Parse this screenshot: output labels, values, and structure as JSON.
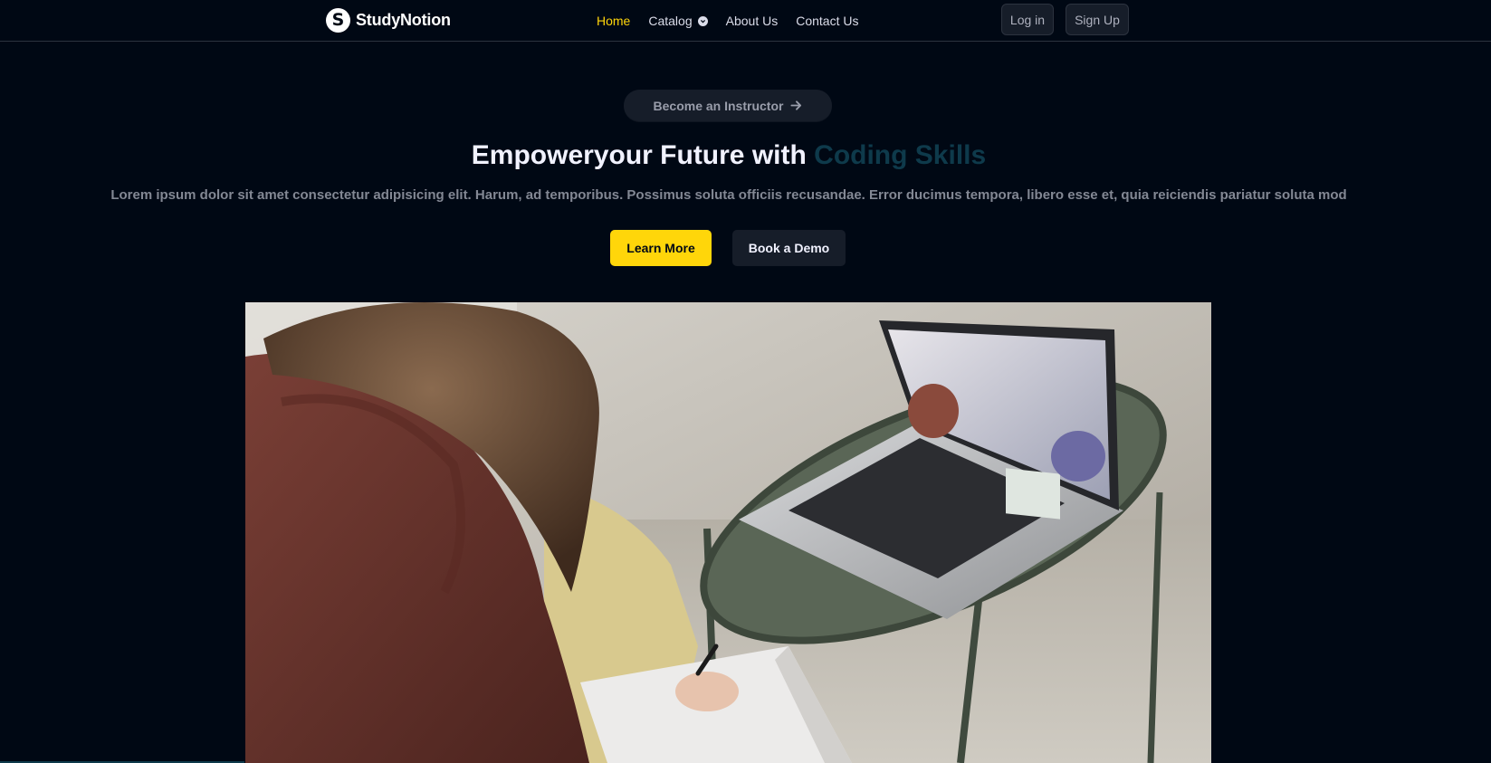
{
  "brand": {
    "logo_letter": "S",
    "name": "StudyNotion"
  },
  "nav": {
    "items": [
      {
        "label": "Home",
        "active": true
      },
      {
        "label": "Catalog",
        "has_dropdown": true
      },
      {
        "label": "About Us"
      },
      {
        "label": "Contact Us"
      }
    ],
    "login_label": "Log in",
    "signup_label": "Sign Up"
  },
  "hero": {
    "instructor_button": "Become an Instructor",
    "headline_prefix": "Empoweryour Future with ",
    "headline_highlight": "Coding Skills",
    "subtext": "Lorem ipsum dolor sit amet consectetur adipisicing elit. Harum, ad temporibus. Possimus soluta officiis recusandae. Error ducimus tempora, libero esse et, quia reiciendis pariatur soluta mod",
    "learn_more": "Learn More",
    "book_demo": "Book a Demo"
  },
  "colors": {
    "background": "#000814",
    "accent_yellow": "#ffd60a",
    "highlight": "#0e3a4b",
    "button_dark": "#161d29"
  }
}
